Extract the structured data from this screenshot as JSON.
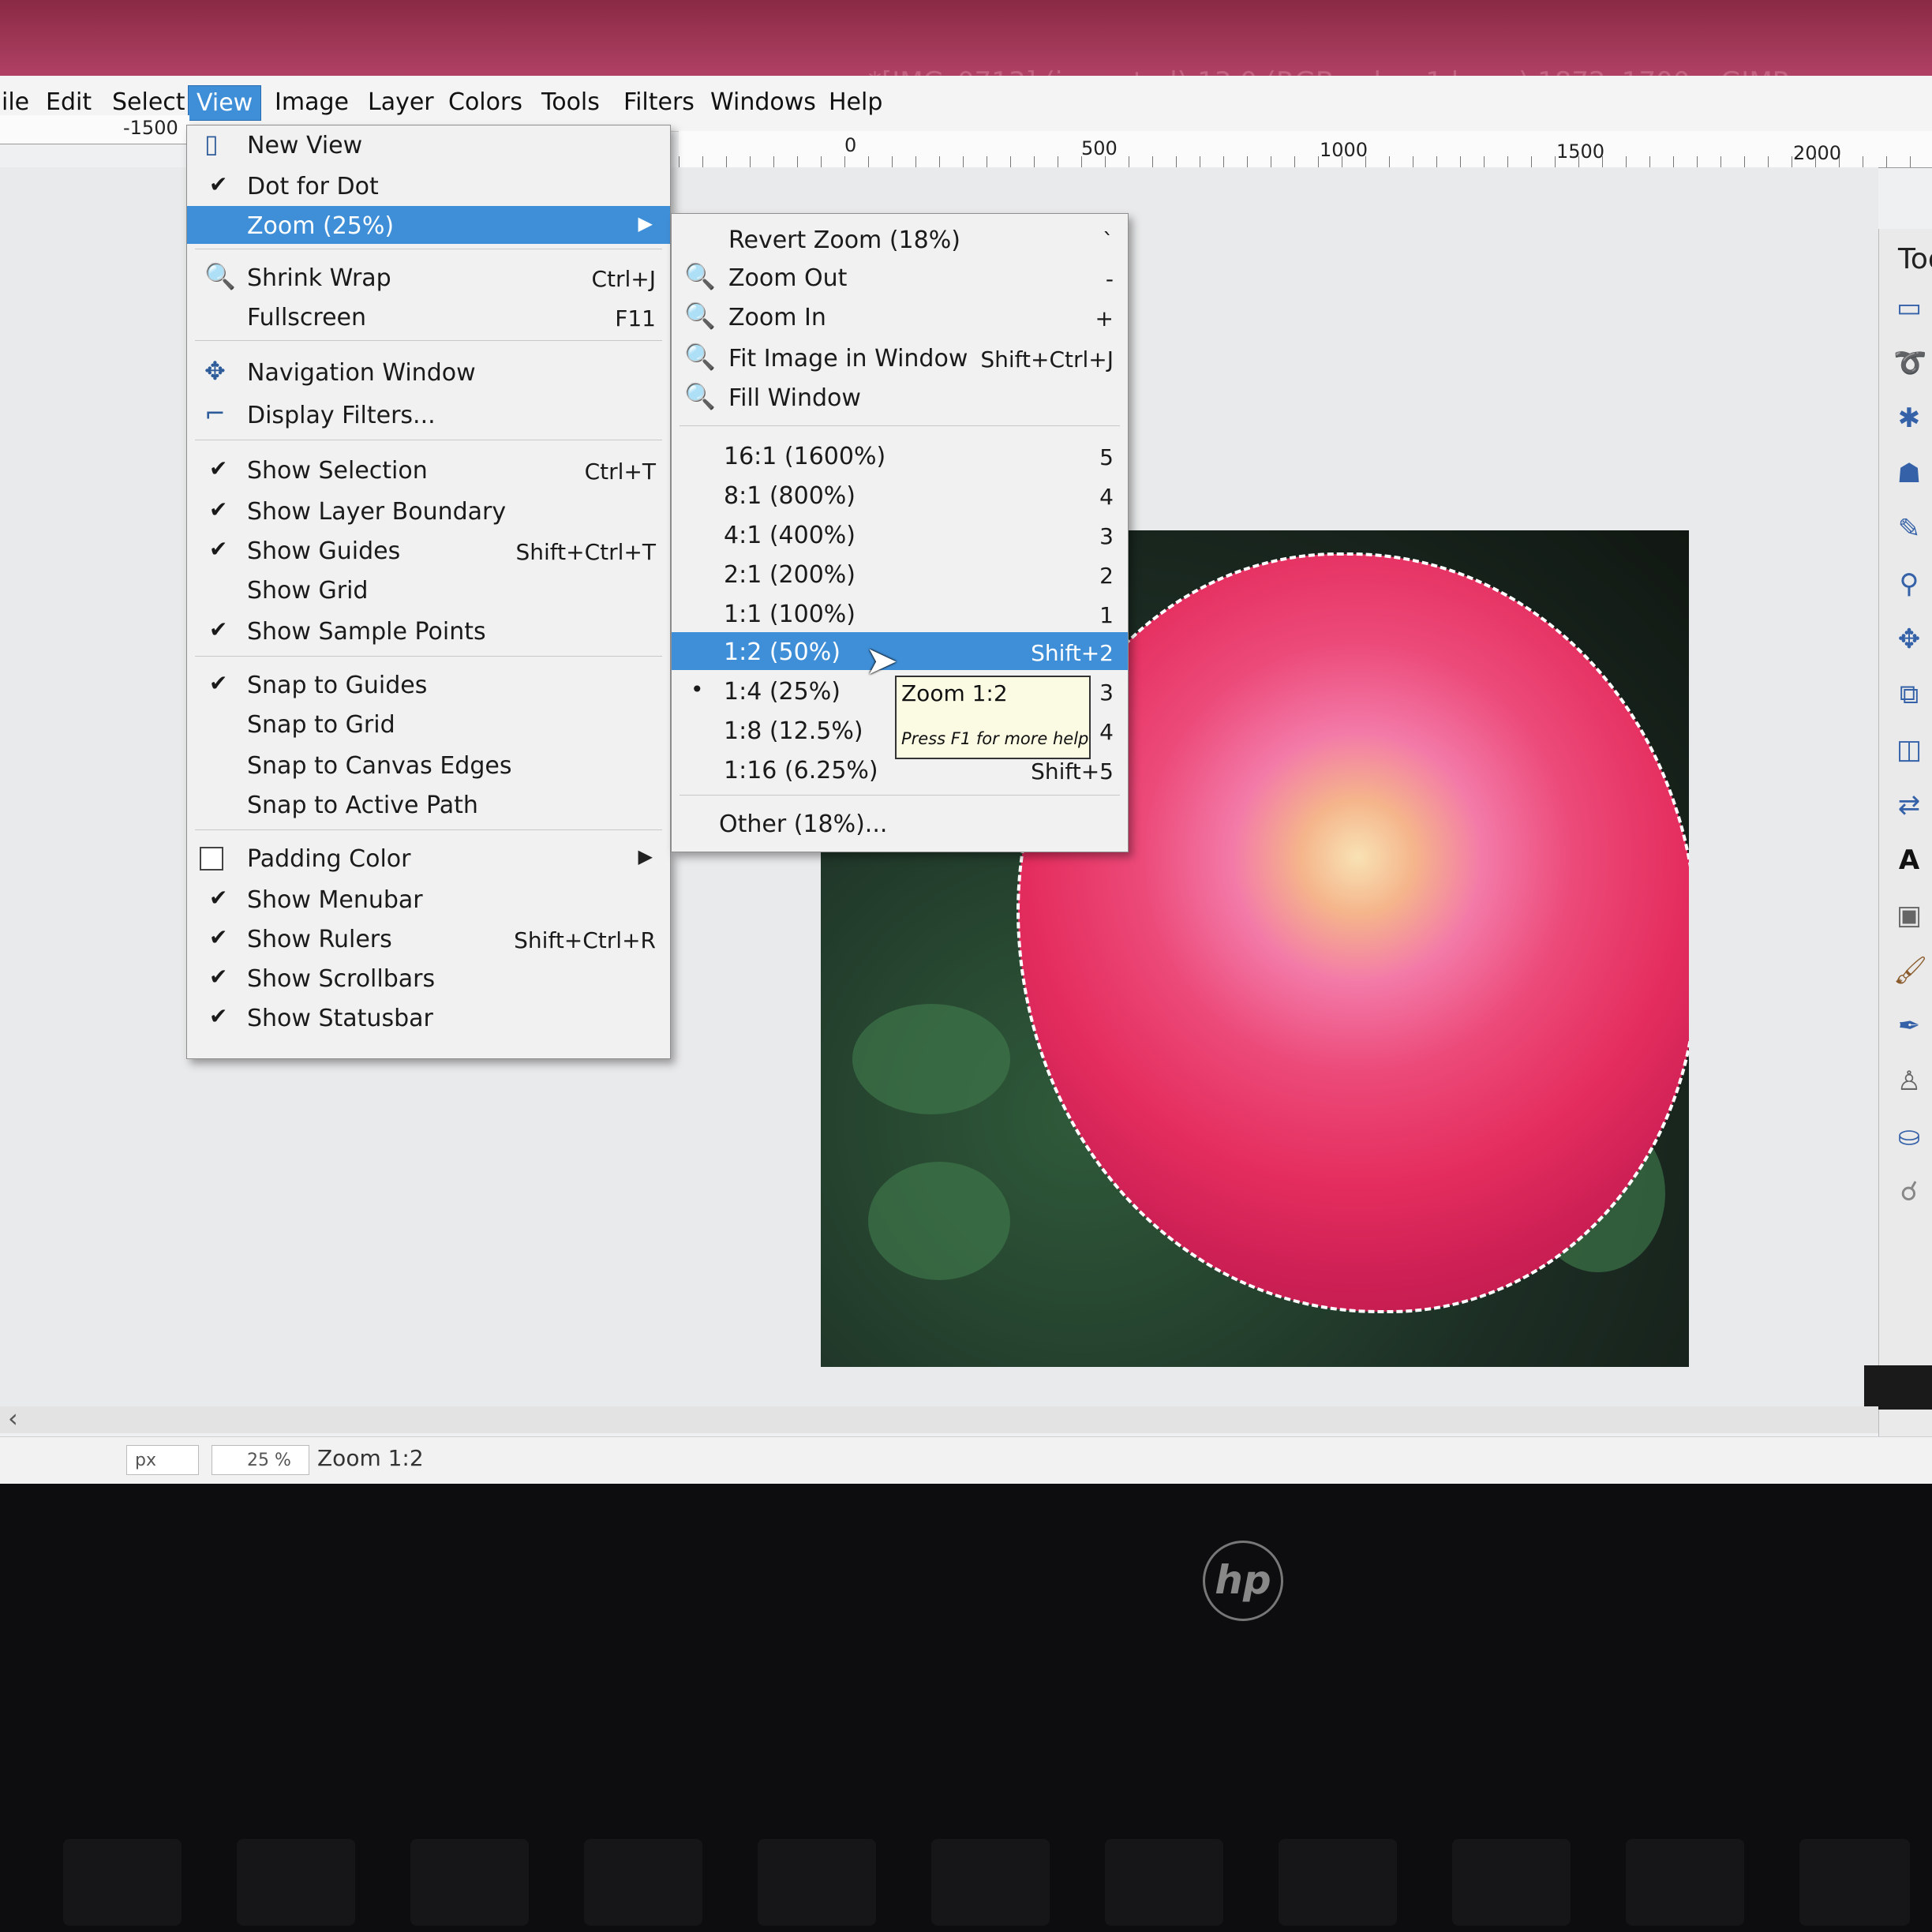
{
  "window": {
    "title": "*[IMG_0713] (imported)-13.0 (RGB color, 1 layer) 1872x1700 – GIMP"
  },
  "menubar": [
    "ile",
    "Edit",
    "Select",
    "View",
    "Image",
    "Layer",
    "Colors",
    "Tools",
    "Filters",
    "Windows",
    "Help"
  ],
  "ruler": {
    "left": "-1500",
    "marks": [
      "0",
      "500",
      "1000",
      "1500",
      "2000"
    ]
  },
  "view_menu": {
    "items": [
      {
        "label": "New View",
        "shortcut": ""
      },
      {
        "label": "Dot for Dot",
        "shortcut": ""
      },
      {
        "label": "Zoom (25%)",
        "shortcut": ""
      },
      {
        "label": "Shrink Wrap",
        "shortcut": "Ctrl+J"
      },
      {
        "label": "Fullscreen",
        "shortcut": "F11"
      },
      {
        "label": "Navigation Window",
        "shortcut": ""
      },
      {
        "label": "Display Filters...",
        "shortcut": ""
      },
      {
        "label": "Show Selection",
        "shortcut": "Ctrl+T"
      },
      {
        "label": "Show Layer Boundary",
        "shortcut": ""
      },
      {
        "label": "Show Guides",
        "shortcut": "Shift+Ctrl+T"
      },
      {
        "label": "Show Grid",
        "shortcut": ""
      },
      {
        "label": "Show Sample Points",
        "shortcut": ""
      },
      {
        "label": "Snap to Guides",
        "shortcut": ""
      },
      {
        "label": "Snap to Grid",
        "shortcut": ""
      },
      {
        "label": "Snap to Canvas Edges",
        "shortcut": ""
      },
      {
        "label": "Snap to Active Path",
        "shortcut": ""
      },
      {
        "label": "Padding Color",
        "shortcut": ""
      },
      {
        "label": "Show Menubar",
        "shortcut": ""
      },
      {
        "label": "Show Rulers",
        "shortcut": "Shift+Ctrl+R"
      },
      {
        "label": "Show Scrollbars",
        "shortcut": ""
      },
      {
        "label": "Show Statusbar",
        "shortcut": ""
      }
    ]
  },
  "zoom_menu": {
    "items": [
      {
        "label": "Revert Zoom (18%)",
        "shortcut": "`"
      },
      {
        "label": "Zoom Out",
        "shortcut": "-"
      },
      {
        "label": "Zoom In",
        "shortcut": "+"
      },
      {
        "label": "Fit Image in Window",
        "shortcut": "Shift+Ctrl+J"
      },
      {
        "label": "Fill Window",
        "shortcut": ""
      },
      {
        "label": "16:1  (1600%)",
        "shortcut": "5"
      },
      {
        "label": "8:1  (800%)",
        "shortcut": "4"
      },
      {
        "label": "4:1  (400%)",
        "shortcut": "3"
      },
      {
        "label": "2:1  (200%)",
        "shortcut": "2"
      },
      {
        "label": "1:1  (100%)",
        "shortcut": "1"
      },
      {
        "label": "1:2  (50%)",
        "shortcut": "Shift+2"
      },
      {
        "label": "1:4  (25%)",
        "shortcut": "3"
      },
      {
        "label": "1:8  (12.5%)",
        "shortcut": "4"
      },
      {
        "label": "1:16  (6.25%)",
        "shortcut": "Shift+5"
      },
      {
        "label": "Other (18%)...",
        "shortcut": ""
      }
    ]
  },
  "tooltip": {
    "title": "Zoom 1:2",
    "help": "Press F1 for more help"
  },
  "toolbox": {
    "title": "Too"
  },
  "statusbar": {
    "unit": "px",
    "zoom": "25 %",
    "message": "Zoom 1:2"
  },
  "bezel": {
    "logo": "hp"
  },
  "colors": {
    "menu_highlight": "#3f8fd8",
    "titlebar": "#b5446a"
  }
}
